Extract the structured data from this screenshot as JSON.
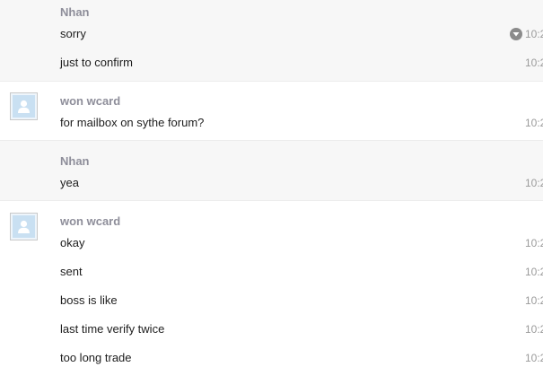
{
  "groups": [
    {
      "sender": "Nhan",
      "messages": [
        {
          "text": "sorry",
          "time": "10:2"
        },
        {
          "text": "just to confirm",
          "time": "10:2"
        }
      ]
    },
    {
      "sender": "won wcard",
      "messages": [
        {
          "text": "for mailbox on sythe forum?",
          "time": "10:2"
        }
      ]
    },
    {
      "sender": "Nhan",
      "messages": [
        {
          "text": "yea",
          "time": "10:2"
        }
      ]
    },
    {
      "sender": "won wcard",
      "messages": [
        {
          "text": "okay",
          "time": "10:2"
        },
        {
          "text": "sent",
          "time": "10:2"
        },
        {
          "text": "boss is like",
          "time": "10:2"
        },
        {
          "text": "last time verify twice",
          "time": "10:2"
        },
        {
          "text": "too long trade",
          "time": "10:2"
        }
      ]
    }
  ],
  "icons": {
    "message_menu": "chevron-down-icon",
    "avatar": "user-silhouette-icon"
  },
  "colors": {
    "sender_name": "#8e8e9a",
    "shaded_background": "#f7f7f7",
    "avatar_fill": "#c9e0f2",
    "timestamp": "#9a9a9a"
  }
}
